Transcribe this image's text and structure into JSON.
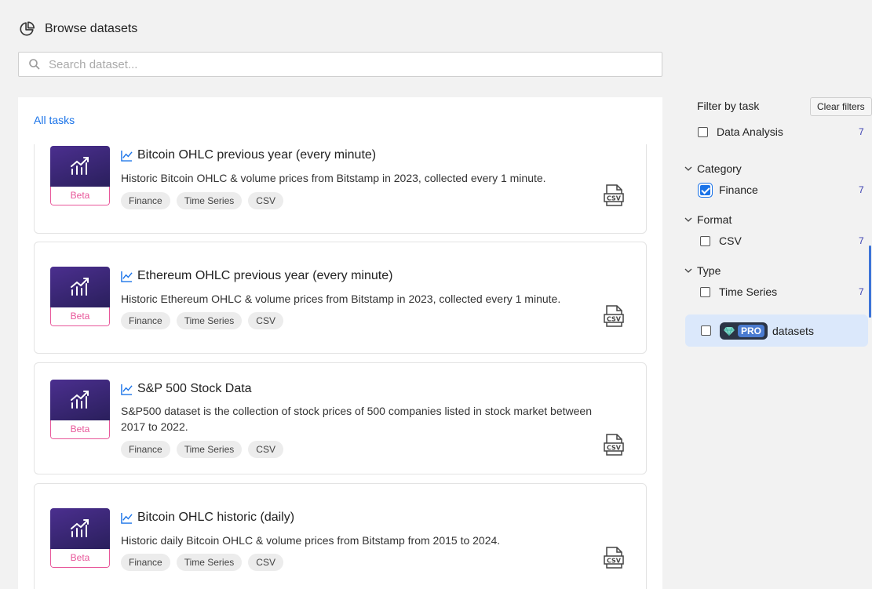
{
  "header": {
    "title": "Browse datasets",
    "icon": "pie-chart-icon"
  },
  "search": {
    "placeholder": "Search dataset..."
  },
  "main": {
    "all_tasks_label": "All tasks",
    "cards": [
      {
        "title": "Bitcoin OHLC previous year (every minute)",
        "description": "Historic Bitcoin OHLC & volume prices from Bitstamp in 2023, collected every 1 minute.",
        "badge": "Beta",
        "tags": [
          "Finance",
          "Time Series",
          "CSV"
        ]
      },
      {
        "title": "Ethereum OHLC previous year (every minute)",
        "description": "Historic Ethereum OHLC & volume prices from Bitstamp in 2023, collected every 1 minute.",
        "badge": "Beta",
        "tags": [
          "Finance",
          "Time Series",
          "CSV"
        ]
      },
      {
        "title": "S&P 500 Stock Data",
        "description": "S&P500 dataset is the collection of stock prices of 500 companies listed in stock market between 2017 to 2022.",
        "badge": "Beta",
        "tags": [
          "Finance",
          "Time Series",
          "CSV"
        ]
      },
      {
        "title": "Bitcoin OHLC historic (daily)",
        "description": "Historic daily Bitcoin OHLC & volume prices from Bitstamp from 2015 to 2024.",
        "badge": "Beta",
        "tags": [
          "Finance",
          "Time Series",
          "CSV"
        ]
      }
    ]
  },
  "sidebar": {
    "filter_title": "Filter by task",
    "clear_filters_label": "Clear filters",
    "task_filters": [
      {
        "label": "Data Analysis",
        "count": "7",
        "checked": false
      }
    ],
    "groups": [
      {
        "title": "Category",
        "items": [
          {
            "label": "Finance",
            "count": "7",
            "checked": true
          }
        ]
      },
      {
        "title": "Format",
        "items": [
          {
            "label": "CSV",
            "count": "7",
            "checked": false
          }
        ]
      },
      {
        "title": "Type",
        "items": [
          {
            "label": "Time Series",
            "count": "7",
            "checked": false
          }
        ]
      }
    ],
    "pro": {
      "badge": "PRO",
      "label": "datasets",
      "checked": false
    }
  },
  "colors": {
    "accent": "#1a73e8",
    "beta": "#e8579a",
    "thumb": "#3a2a78",
    "pro_bg": "#dbe8fb"
  }
}
